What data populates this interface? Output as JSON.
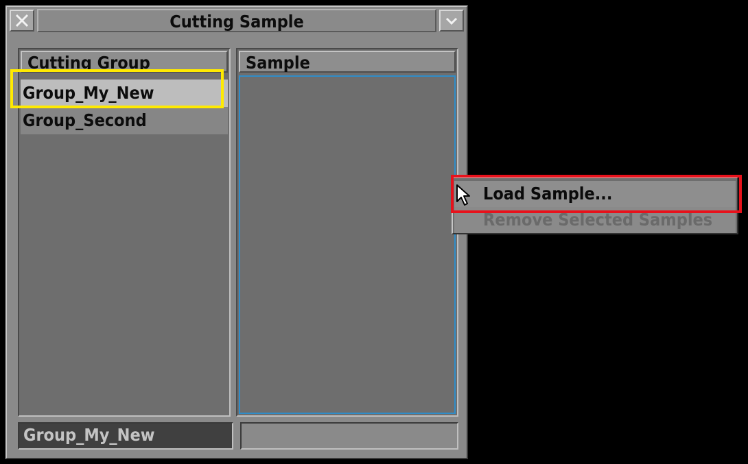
{
  "window": {
    "title": "Cutting Sample"
  },
  "titlebar": {
    "close_icon": "close-icon",
    "menu_icon": "chevron-down-icon"
  },
  "left_panel": {
    "header": "Cutting Group",
    "items": [
      {
        "label": "Group_My_New",
        "selected": true
      },
      {
        "label": "Group_Second",
        "selected": false
      }
    ]
  },
  "right_panel": {
    "header": "Sample",
    "items": []
  },
  "status": {
    "left_value": "Group_My_New",
    "right_value": ""
  },
  "context_menu": {
    "items": [
      {
        "label": "Load Sample...",
        "enabled": true
      },
      {
        "label": "Remove Selected Samples",
        "enabled": false
      }
    ]
  },
  "colors": {
    "window_bg": "#8a8a8a",
    "list_bg": "#6e6e6e",
    "focus_border": "#2f8dc9",
    "highlight_yellow": "#ffea00",
    "highlight_red": "#e8111b"
  },
  "cursor_icon": "arrow-pointer-icon"
}
